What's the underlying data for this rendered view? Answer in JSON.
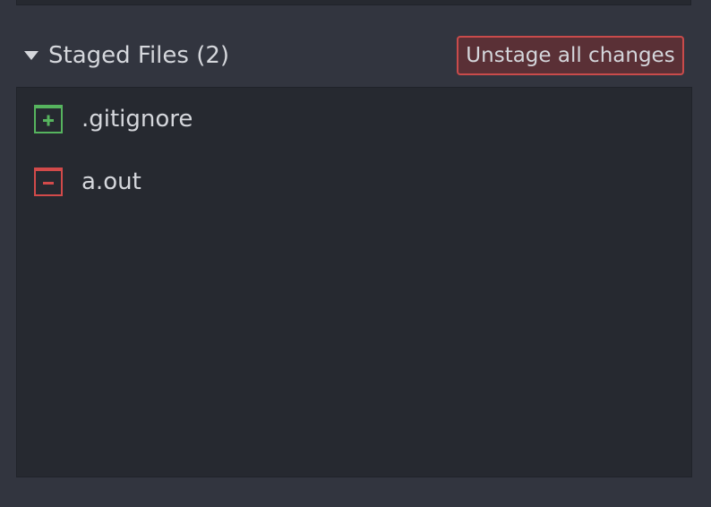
{
  "staged_section": {
    "title": "Staged Files (2)",
    "unstage_button_label": "Unstage all changes",
    "files": [
      {
        "name": ".gitignore",
        "status": "added",
        "icon": "file-added-icon",
        "color": "#56b45e"
      },
      {
        "name": "a.out",
        "status": "deleted",
        "icon": "file-deleted-icon",
        "color": "#d24a4a"
      }
    ]
  },
  "colors": {
    "background": "#32353f",
    "panel": "#262930",
    "text": "#d5d7dc",
    "danger_border": "#c94b4b",
    "danger_fill": "#5a3036"
  }
}
